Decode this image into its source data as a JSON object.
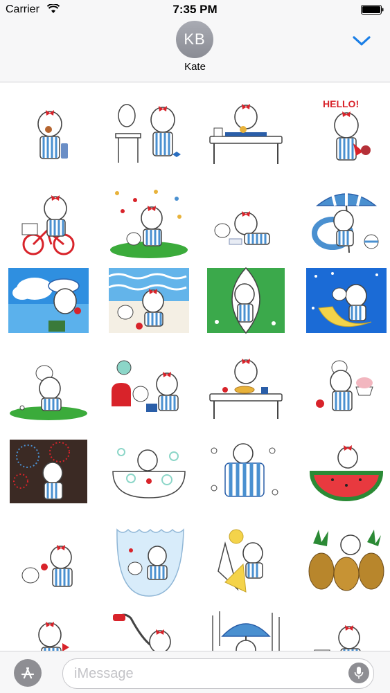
{
  "status_bar": {
    "carrier": "Carrier",
    "time": "7:35 PM"
  },
  "header": {
    "avatar_initials": "KB",
    "contact_name": "Kate"
  },
  "stickers": {
    "hello_text": "HELLO!",
    "items": [
      "girl-eating",
      "girl-at-vanity",
      "girl-at-desk",
      "girl-hello-waving",
      "girl-on-bicycle",
      "girl-with-puppy-flowers",
      "girl-with-puppy-reading",
      "girl-beach-umbrella",
      "girl-sea-hat",
      "girl-beach-waves",
      "girl-hammock",
      "girl-on-moon",
      "girl-with-puppy-grass",
      "girl-with-toys",
      "girl-pancakes",
      "girl-shaved-ice",
      "girl-fireworks",
      "girl-bubble-bath",
      "girl-sleeping-blanket",
      "girl-watermelon",
      "girl-puppy-hug",
      "girl-goldfish-bowl",
      "girl-ice-cream-cone",
      "girl-pineapples",
      "girl-partial-1",
      "girl-vacuum",
      "girl-rain-umbrella",
      "girl-bicycle-partial"
    ]
  },
  "input_bar": {
    "placeholder": "iMessage"
  },
  "colors": {
    "accent": "#1a7ee6",
    "brand_red": "#d8232a",
    "stripe_blue": "#4a90d0"
  }
}
